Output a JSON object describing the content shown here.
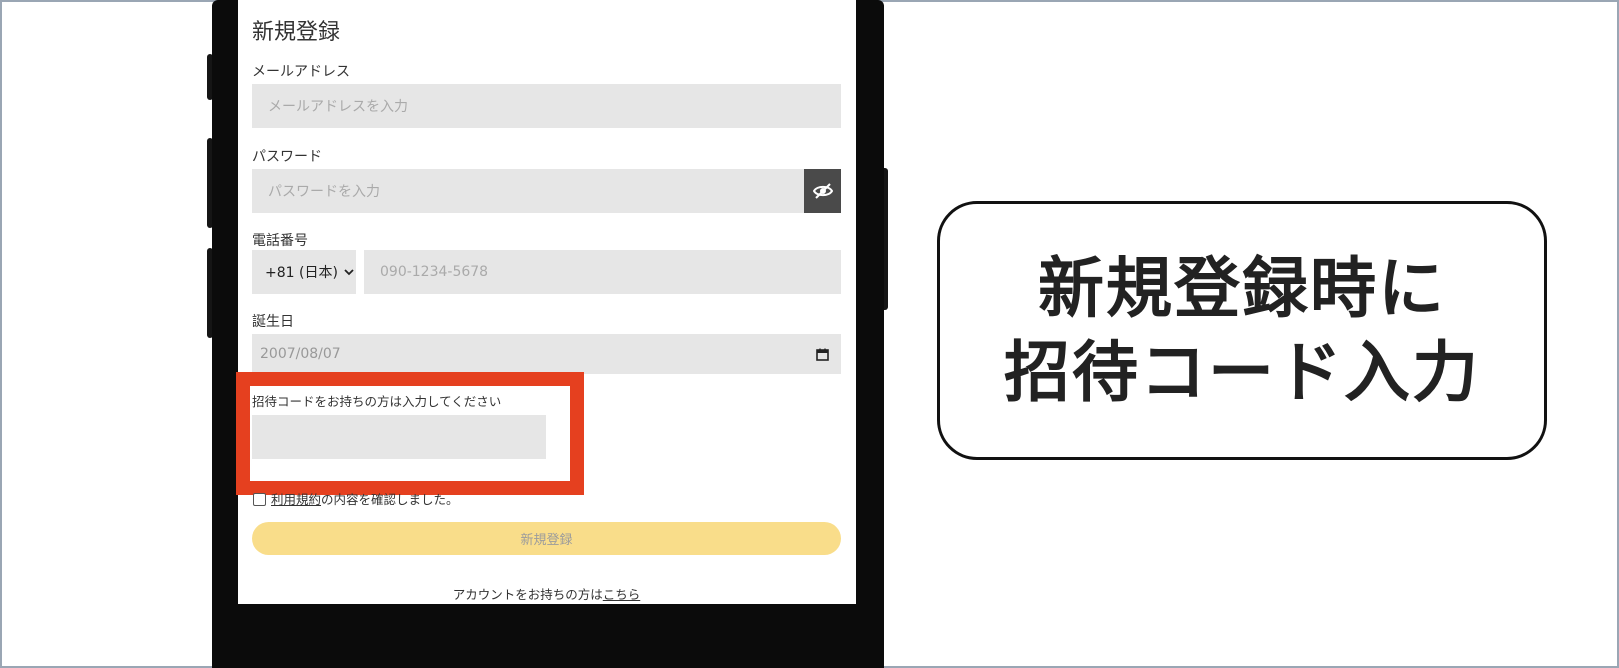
{
  "form": {
    "title": "新規登録",
    "email": {
      "label": "メールアドレス",
      "placeholder": "メールアドレスを入力"
    },
    "password": {
      "label": "パスワード",
      "placeholder": "パスワードを入力"
    },
    "phone": {
      "label": "電話番号",
      "country_code": "+81 (日本)",
      "placeholder": "090-1234-5678"
    },
    "birthday": {
      "label": "誕生日",
      "value": "2007/08/07"
    },
    "invite": {
      "label": "招待コードをお持ちの方は入力してください",
      "value": ""
    },
    "terms": {
      "link_text": "利用規約",
      "rest_text": "の内容を確認しました。"
    },
    "submit_label": "新規登録",
    "login": {
      "prefix": "アカウントをお持ちの方は",
      "link_text": "こちら"
    }
  },
  "callout": {
    "line1": "新規登録時に",
    "line2": "招待コード入力"
  },
  "colors": {
    "highlight": "#e5401f",
    "submit_bg": "#f9dd8a",
    "field_bg": "#e6e6e6"
  },
  "icons": [
    "eye-off-icon",
    "calendar-icon",
    "chevron-down-icon"
  ]
}
